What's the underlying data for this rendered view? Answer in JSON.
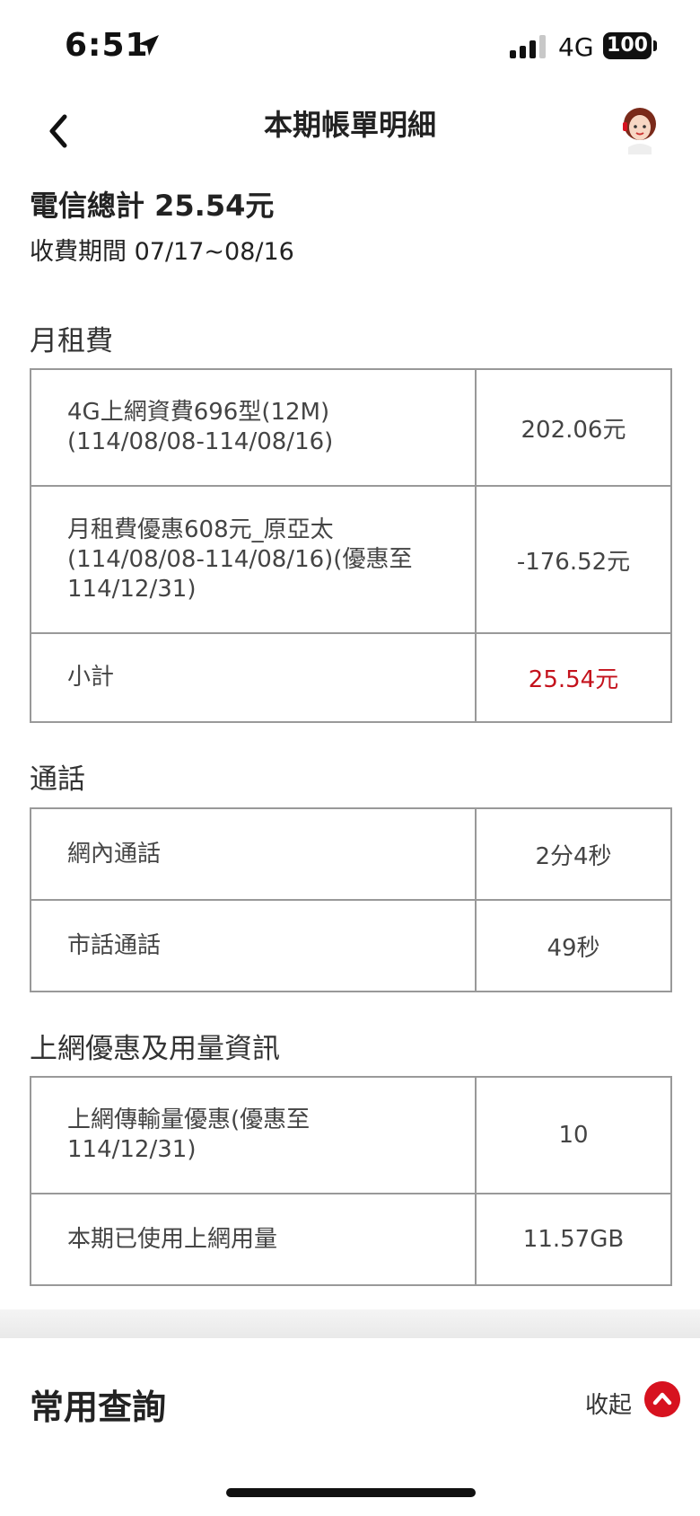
{
  "status_bar": {
    "time": "6:51",
    "network": "4G",
    "battery": "100"
  },
  "nav": {
    "title": "本期帳單明細",
    "back_icon": "chevron-left-icon",
    "avatar_icon": "customer-service-avatar-icon"
  },
  "summary": {
    "total": "電信總計 25.54元",
    "period": "收費期間 07/17~08/16"
  },
  "sections": {
    "monthly": {
      "title": "月租費",
      "rows": [
        {
          "label": "4G上網資費696型(12M)\n(114/08/08-114/08/16)",
          "value": "202.06元"
        },
        {
          "label": "月租費優惠608元_原亞太\n(114/08/08-114/08/16)(優惠至\n114/12/31)",
          "value": "-176.52元"
        },
        {
          "label": "小計",
          "value": "25.54元"
        }
      ]
    },
    "calls": {
      "title": "通話",
      "rows": [
        {
          "label": "網內通話",
          "value": "2分4秒"
        },
        {
          "label": "市話通話",
          "value": "49秒"
        }
      ]
    },
    "data": {
      "title": "上網優惠及用量資訊",
      "rows": [
        {
          "label": "上網傳輸量優惠(優惠至\n114/12/31)",
          "value": "10"
        },
        {
          "label": "本期已使用上網用量",
          "value": "11.57GB"
        }
      ]
    }
  },
  "quick_query": {
    "title": "常用查詢",
    "collapse_label": "收起",
    "collapse_icon": "chevron-up-icon"
  },
  "colors": {
    "accent_red": "#d7121f",
    "subtotal_red": "#c4121c",
    "border_gray": "#999999"
  }
}
